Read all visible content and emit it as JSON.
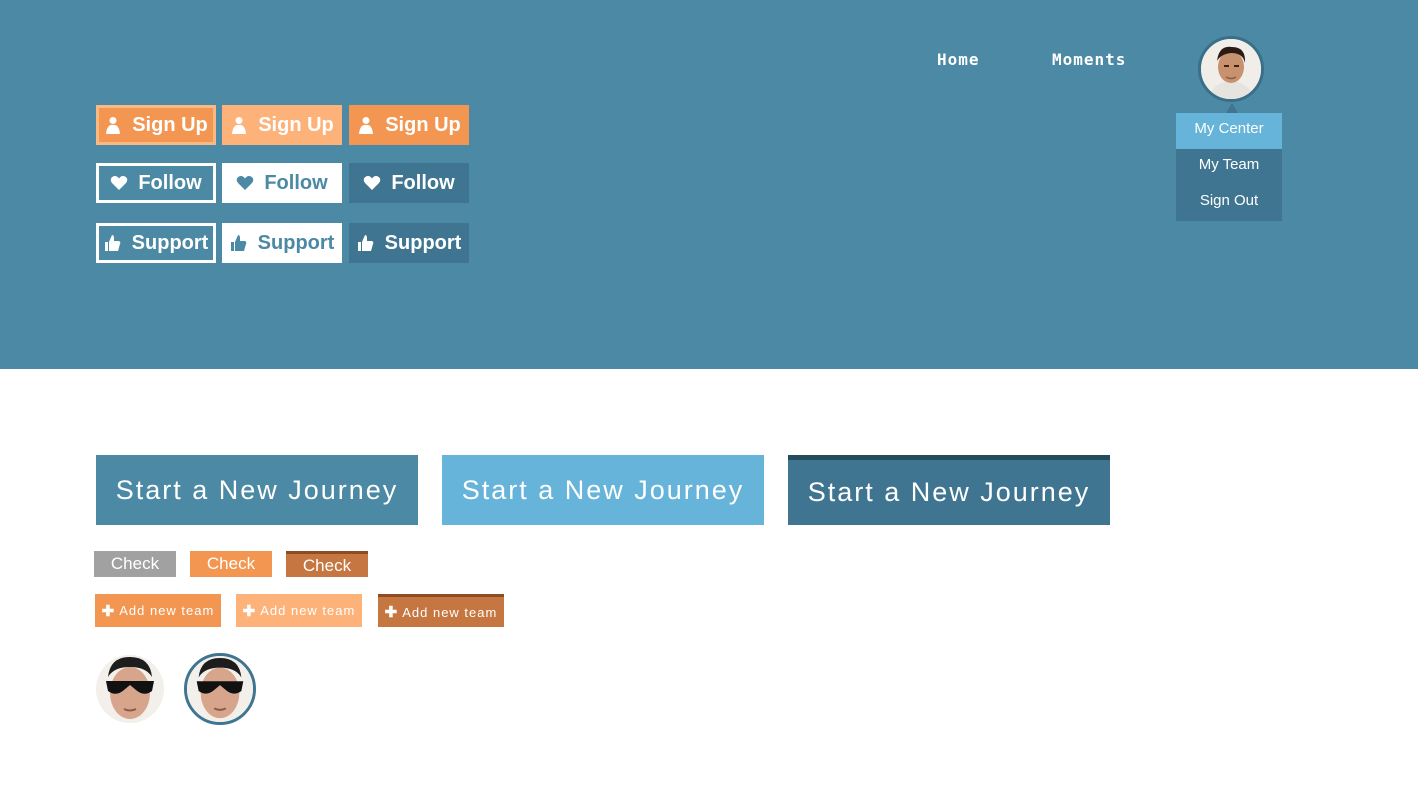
{
  "nav": {
    "home": "Home",
    "moments": "Moments"
  },
  "dropdown": {
    "items": [
      "My Center",
      "My Team",
      "Sign Out"
    ]
  },
  "buttons": {
    "sign_up": "Sign Up",
    "follow": "Follow",
    "support": "Support",
    "journey": "Start a New Journey",
    "check": "Check",
    "add_team": "Add new team"
  },
  "icons": {
    "sign_up": "user-icon",
    "follow": "heart-icon",
    "support": "thumbs-up-icon",
    "add_team": "plus-icon"
  },
  "colors": {
    "hero_bg": "#4b89a4",
    "orange": "#f29652",
    "light_orange": "#fdb27a",
    "dark_orange": "#c67640",
    "light_blue": "#66b4d9",
    "dark_blue": "#3f7590",
    "gray": "#a1a1a1"
  }
}
